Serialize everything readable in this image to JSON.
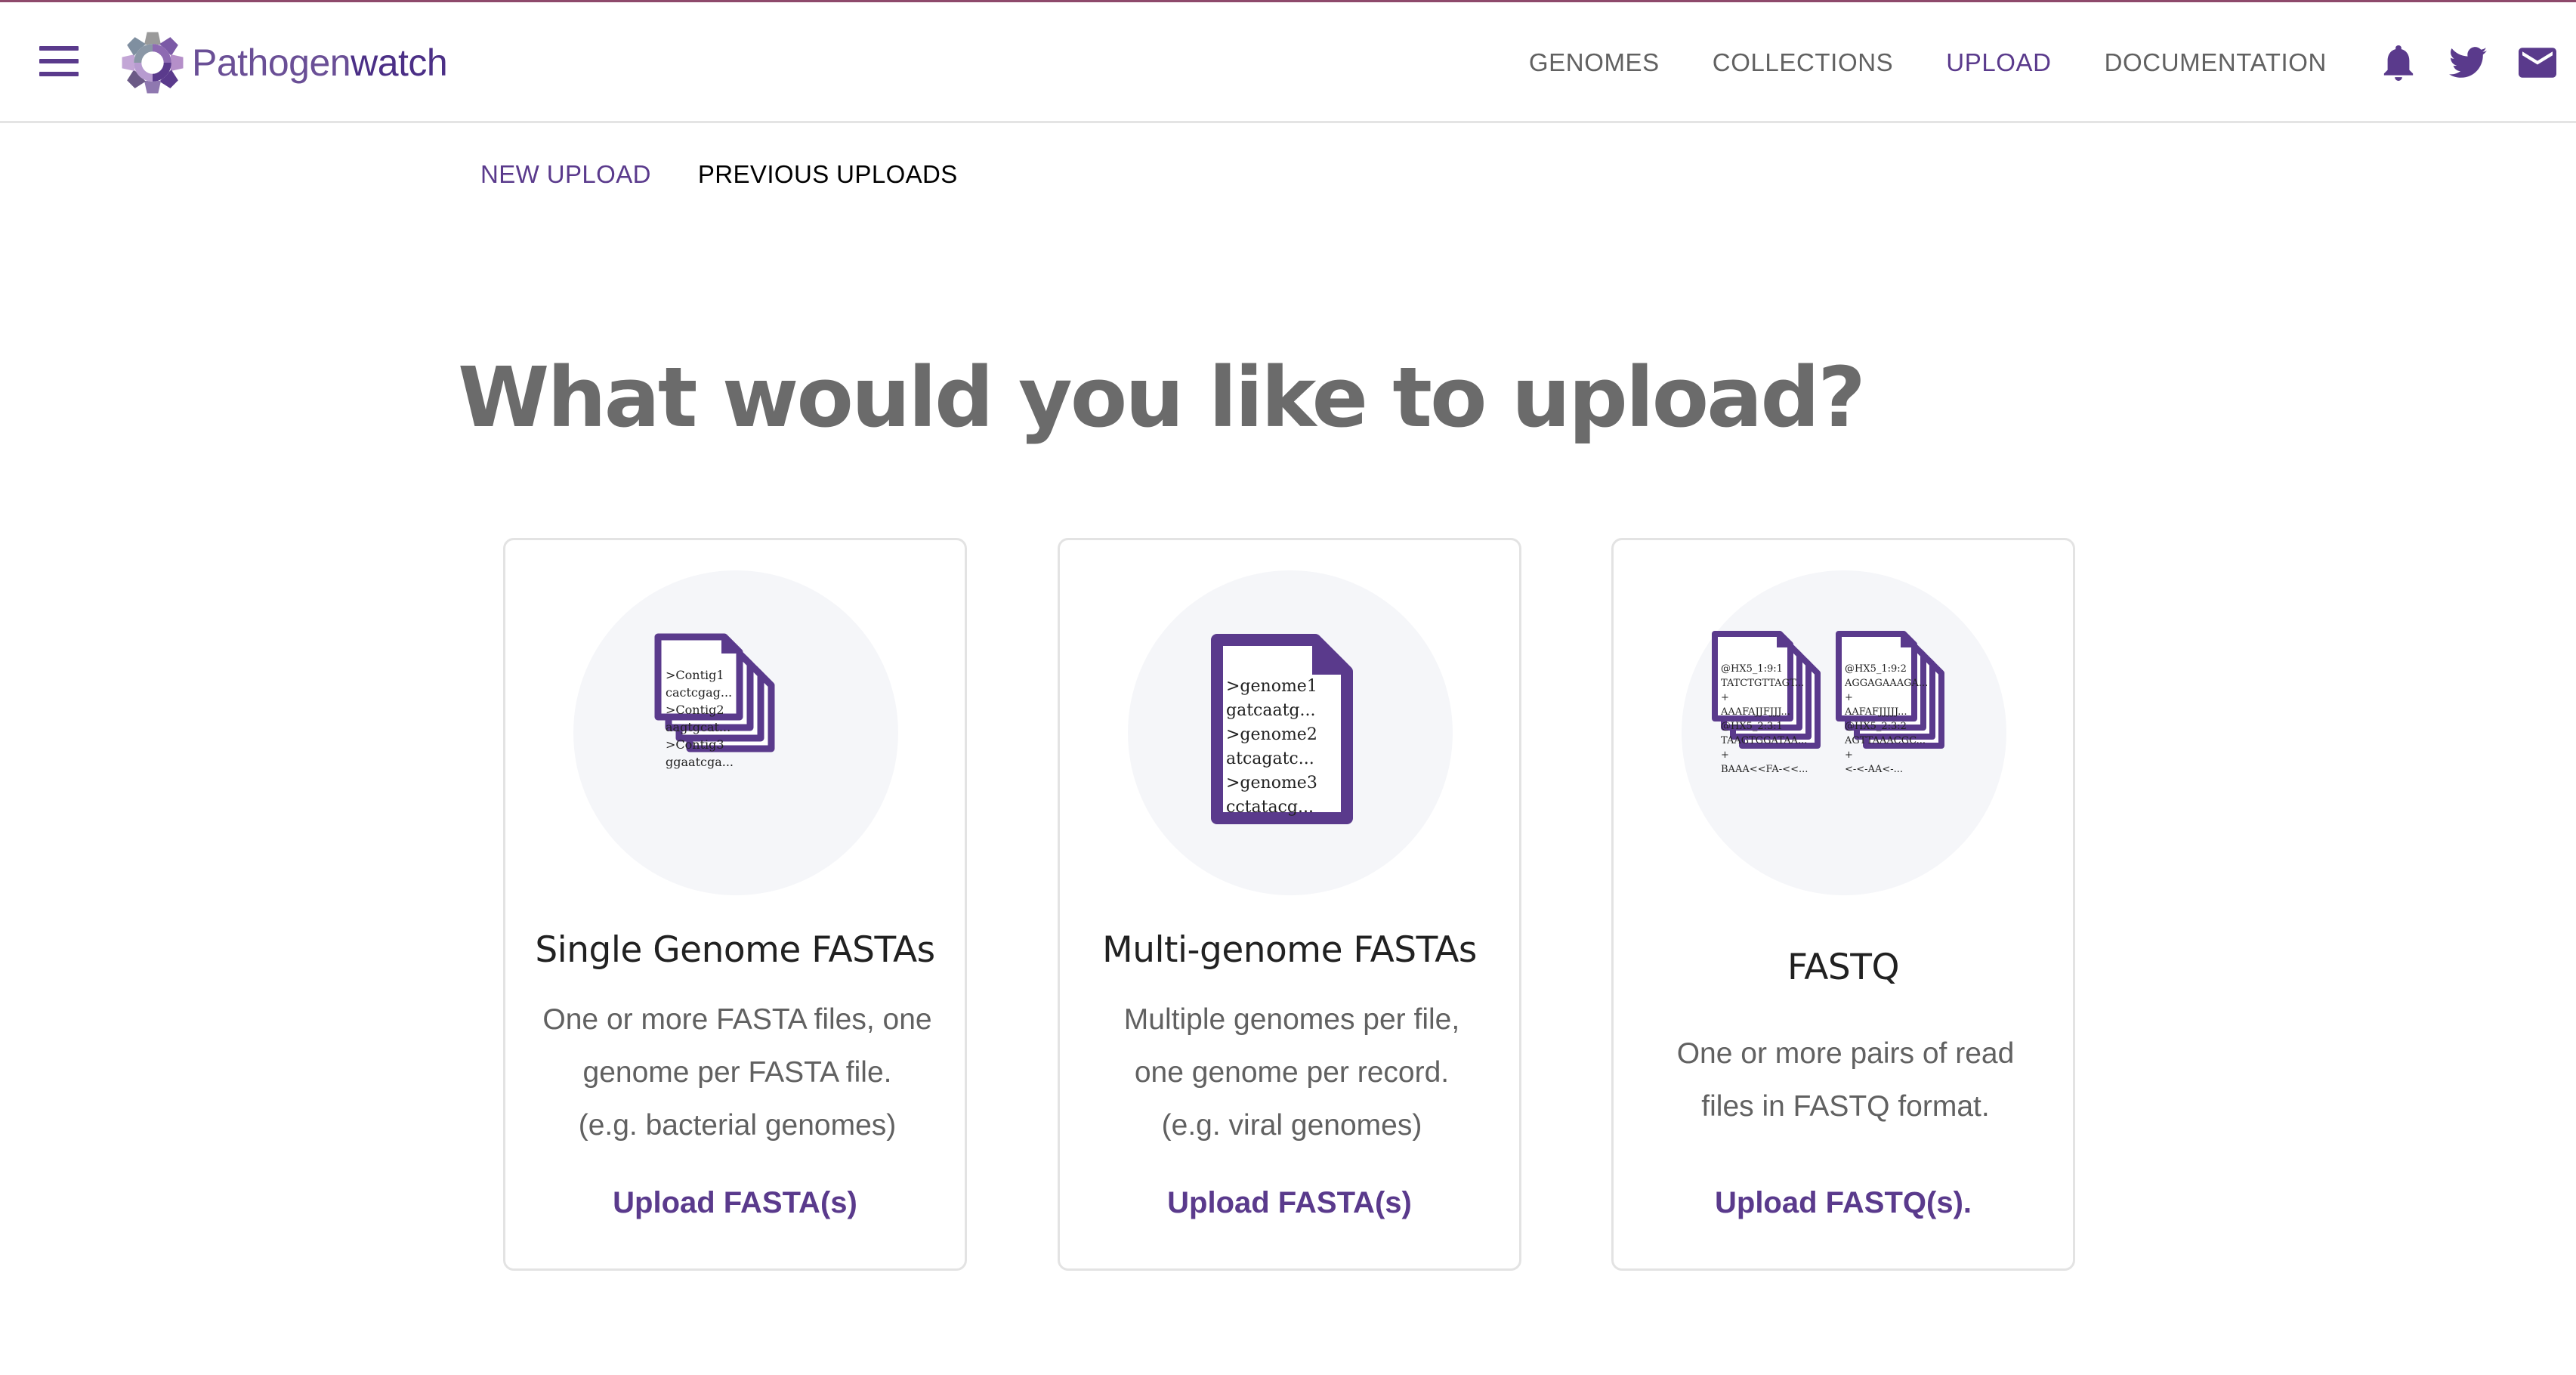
{
  "app": {
    "brand_light": "Pathogen",
    "brand_strong": "watch"
  },
  "colors": {
    "accent": "#5a3a8c",
    "top_accent": "#8e4a6b",
    "muted_text": "#616161"
  },
  "nav": {
    "items": [
      {
        "label": "GENOMES",
        "active": false
      },
      {
        "label": "COLLECTIONS",
        "active": false
      },
      {
        "label": "UPLOAD",
        "active": true
      },
      {
        "label": "DOCUMENTATION",
        "active": false
      }
    ],
    "icons": [
      "bell-icon",
      "twitter-icon",
      "mail-icon"
    ]
  },
  "subtabs": [
    {
      "label": "NEW UPLOAD",
      "active": true
    },
    {
      "label": "PREVIOUS UPLOADS",
      "active": false
    }
  ],
  "heading": "What would you like to upload?",
  "cards": [
    {
      "title": "Single Genome FASTAs",
      "desc_lines": [
        "One or more FASTA files, one",
        "genome per FASTA file.",
        "(e.g. bacterial genomes)"
      ],
      "link": "Upload FASTA(s)",
      "doc_lines": [
        ">Contig1",
        "cactcgag...",
        ">Contig2",
        "aagtgcat...",
        ">Contig3",
        "ggaatcga..."
      ]
    },
    {
      "title": "Multi-genome FASTAs",
      "desc_lines": [
        "Multiple genomes per file,",
        "one genome per record.",
        "(e.g. viral genomes)"
      ],
      "link": "Upload FASTA(s)",
      "doc_lines": [
        ">genome1",
        "gatcaatg...",
        ">genome2",
        "atcagatc...",
        ">genome3",
        "cctatacg..."
      ]
    },
    {
      "title": "FASTQ",
      "desc_lines": [
        "One or more pairs of read",
        "files in FASTQ format."
      ],
      "link": "Upload FASTQ(s).",
      "doc_left_lines": [
        "@HX5_1:9:1",
        "TATCTGTTAGT...",
        "+",
        "AAAFAJJFJJJ...",
        "@HX5_2:3:1",
        "TAAGTGGATAA...",
        "+",
        "BAAA<<FA-<<..."
      ],
      "doc_right_lines": [
        "@HX5_1:9:2",
        "AGGAGAAAGA...",
        "+",
        "AAFAFJJJJJ...",
        "@HX5_2:3:2",
        "AGTTAAACGC...",
        "+",
        "<-<-AA<-..."
      ]
    }
  ]
}
